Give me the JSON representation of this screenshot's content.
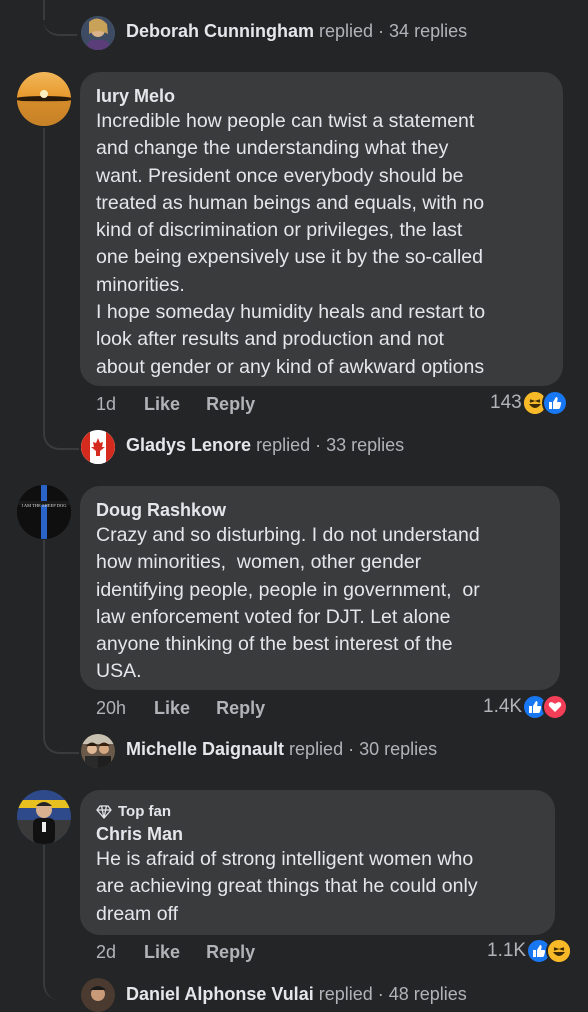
{
  "colors": {
    "background": "#242526",
    "bubble": "#3a3b3c",
    "text_primary": "#e4e6eb",
    "text_secondary": "#b0b3b8",
    "like_blue": "#1877f2",
    "love_red": "#f33e58",
    "haha_yellow": "#f7b928"
  },
  "thread_rows": [
    {
      "name": "Deborah Cunningham",
      "suffix": "replied · 34 replies"
    },
    {
      "name": "Gladys Lenore",
      "suffix": "replied · 33 replies"
    },
    {
      "name": "Michelle Daignault",
      "suffix": "replied · 30 replies"
    },
    {
      "name": "Daniel Alphonse Vulai",
      "suffix": "replied · 48 replies"
    }
  ],
  "comments": [
    {
      "author": "Iury Melo",
      "text": "Incredible how people can twist a statement\nand change the understanding what they\nwant. President once everybody should be\ntreated as human beings and equals, with no\nkind of discrimination or privileges, the last\none being expensively use it by the so-called\nminorities.\nI hope someday humidity heals and restart to\nlook after results and production and not\nabout gender or any kind of awkward options",
      "time": "1d",
      "like": "Like",
      "reply": "Reply",
      "reaction_count": "143",
      "reactions": [
        "haha-icon",
        "like-icon"
      ]
    },
    {
      "author": "Doug Rashkow",
      "avatar_caption": "I AM THE SHEEP DOG",
      "text": "Crazy and so disturbing. I do not understand\nhow minorities,  women, other gender\nidentifying people, people in government,  or\nlaw enforcement voted for DJT. Let alone\nanyone thinking of the best interest of the\nUSA.",
      "time": "20h",
      "like": "Like",
      "reply": "Reply",
      "reaction_count": "1.4K",
      "reactions": [
        "like-icon",
        "love-icon"
      ]
    },
    {
      "badge": "Top fan",
      "author": "Chris Man",
      "text": "He is afraid of strong intelligent women who\nare achieving great things that he could only\ndream off",
      "time": "2d",
      "like": "Like",
      "reply": "Reply",
      "reaction_count": "1.1K",
      "reactions": [
        "like-icon",
        "haha-icon"
      ]
    }
  ]
}
